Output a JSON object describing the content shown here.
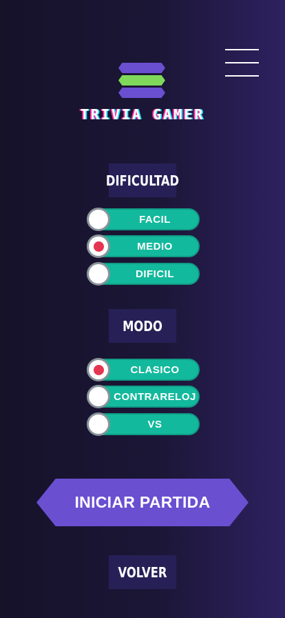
{
  "header": {
    "app_title": "TRIVIA GAMER",
    "menu_icon": "hamburger-menu-icon",
    "logo_icon": "stacked-hexagon-bars-logo"
  },
  "difficulty": {
    "label": "DIFICULTAD",
    "options": [
      {
        "label": "FACIL",
        "selected": false
      },
      {
        "label": "MEDIO",
        "selected": true
      },
      {
        "label": "DIFICIL",
        "selected": false
      }
    ]
  },
  "mode": {
    "label": "MODO",
    "options": [
      {
        "label": "CLASICO",
        "selected": true
      },
      {
        "label": "CONTRARELOJ",
        "selected": false
      },
      {
        "label": "VS",
        "selected": false
      }
    ]
  },
  "actions": {
    "start_label": "INICIAR PARTIDA",
    "back_label": "VOLVER"
  },
  "colors": {
    "background": "#1b1636",
    "accent_purple": "#6a4fd1",
    "accent_green": "#7fd85a",
    "option_teal": "#13b99c",
    "selected_red": "#e53550",
    "label_bg": "#272057"
  }
}
